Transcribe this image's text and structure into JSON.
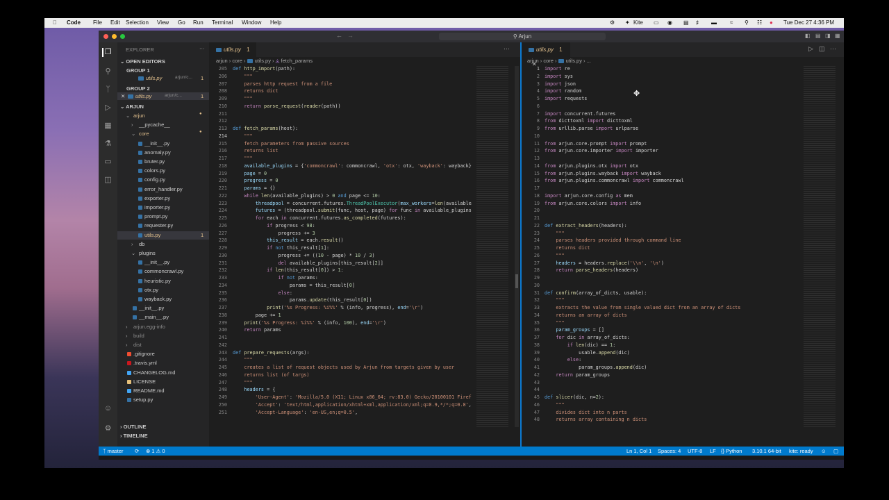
{
  "menubar": {
    "app": "Code",
    "items": [
      "File",
      "Edit",
      "Selection",
      "View",
      "Go",
      "Run",
      "Terminal",
      "Window",
      "Help"
    ],
    "kite": "Kite",
    "clock": "Tue Dec 27  4:36 PM"
  },
  "titlebar": {
    "search": "Arjun"
  },
  "sidebar": {
    "title": "EXPLORER",
    "open_editors": "OPEN EDITORS",
    "group1": "GROUP 1",
    "group1_file": "utils.py",
    "group1_path": "arjun/c...",
    "group1_badge": "1",
    "group2": "GROUP 2",
    "group2_file": "utils.py",
    "group2_path": "arjun/c...",
    "group2_badge": "1",
    "project": "ARJUN",
    "tree": [
      {
        "label": "arjun",
        "indent": 1,
        "kind": "folder",
        "open": true,
        "mod": true
      },
      {
        "label": "__pycache__",
        "indent": 2,
        "kind": "folder",
        "open": false,
        "mod": false
      },
      {
        "label": "core",
        "indent": 2,
        "kind": "folder",
        "open": true,
        "mod": true
      },
      {
        "label": "__init__.py",
        "indent": 3,
        "kind": "file",
        "mod": false
      },
      {
        "label": "anomaly.py",
        "indent": 3,
        "kind": "file",
        "mod": false
      },
      {
        "label": "bruter.py",
        "indent": 3,
        "kind": "file",
        "mod": false
      },
      {
        "label": "colors.py",
        "indent": 3,
        "kind": "file",
        "mod": false
      },
      {
        "label": "config.py",
        "indent": 3,
        "kind": "file",
        "mod": false
      },
      {
        "label": "error_handler.py",
        "indent": 3,
        "kind": "file",
        "mod": false
      },
      {
        "label": "exporter.py",
        "indent": 3,
        "kind": "file",
        "mod": false
      },
      {
        "label": "importer.py",
        "indent": 3,
        "kind": "file",
        "mod": false
      },
      {
        "label": "prompt.py",
        "indent": 3,
        "kind": "file",
        "mod": false
      },
      {
        "label": "requester.py",
        "indent": 3,
        "kind": "file",
        "mod": false
      },
      {
        "label": "utils.py",
        "indent": 3,
        "kind": "file",
        "mod": true,
        "selected": true,
        "badge": "1"
      },
      {
        "label": "db",
        "indent": 2,
        "kind": "folder",
        "open": false,
        "mod": false
      },
      {
        "label": "plugins",
        "indent": 2,
        "kind": "folder",
        "open": true,
        "mod": false
      },
      {
        "label": "__init__.py",
        "indent": 3,
        "kind": "file",
        "mod": false
      },
      {
        "label": "commoncrawl.py",
        "indent": 3,
        "kind": "file",
        "mod": false
      },
      {
        "label": "heuristic.py",
        "indent": 3,
        "kind": "file",
        "mod": false
      },
      {
        "label": "otx.py",
        "indent": 3,
        "kind": "file",
        "mod": false
      },
      {
        "label": "wayback.py",
        "indent": 3,
        "kind": "file",
        "mod": false
      },
      {
        "label": "__init__.py",
        "indent": 2,
        "kind": "file",
        "mod": false
      },
      {
        "label": "__main__.py",
        "indent": 2,
        "kind": "file",
        "mod": false
      },
      {
        "label": "arjun.egg-info",
        "indent": 1,
        "kind": "folder",
        "open": false,
        "mod": false,
        "dim": true
      },
      {
        "label": "build",
        "indent": 1,
        "kind": "folder",
        "open": false,
        "mod": false,
        "dim": true
      },
      {
        "label": "dist",
        "indent": 1,
        "kind": "folder",
        "open": false,
        "mod": false,
        "dim": true
      },
      {
        "label": ".gitignore",
        "indent": 1,
        "kind": "file",
        "mod": false
      },
      {
        "label": ".travis.yml",
        "indent": 1,
        "kind": "file",
        "mod": false
      },
      {
        "label": "CHANGELOG.md",
        "indent": 1,
        "kind": "file",
        "mod": false
      },
      {
        "label": "LICENSE",
        "indent": 1,
        "kind": "file",
        "mod": false
      },
      {
        "label": "README.md",
        "indent": 1,
        "kind": "file",
        "mod": false
      },
      {
        "label": "setup.py",
        "indent": 1,
        "kind": "file",
        "mod": false
      }
    ],
    "outline": "OUTLINE",
    "timeline": "TIMELINE"
  },
  "editor_left": {
    "tab": "utils.py",
    "tab_badge": "1",
    "breadcrumb": [
      "arjun",
      "core",
      "utils.py",
      "fetch_params"
    ],
    "line_start": 205,
    "lines": [
      "<span class='k'>def</span> <span class='fn'>http_import</span>(path):",
      "    <span class='st'>\"\"\"</span>",
      "    <span class='st'>parses http request from a file</span>",
      "    <span class='st'>returns dict</span>",
      "    <span class='st'>\"\"\"</span>",
      "    <span class='kw'>return</span> <span class='fn'>parse_request</span>(<span class='fn'>reader</span>(path))",
      "",
      "",
      "<span class='k'>def</span> <span class='fn'>fetch_params</span>(host):",
      "    <span class='st'>\"\"\"</span>",
      "    <span class='st'>fetch parameters from passive sources</span>",
      "    <span class='st'>returns list</span>",
      "    <span class='st'>\"\"\"</span>",
      "    <span class='vr'>available_plugins</span> = {<span class='st'>'commoncrawl'</span>: commoncrawl, <span class='st'>'otx'</span>: otx, <span class='st'>'wayback'</span>: wayback}",
      "    <span class='vr'>page</span> = <span class='nm'>0</span>",
      "    <span class='vr'>progress</span> = <span class='nm'>0</span>",
      "    <span class='vr'>params</span> = {}",
      "    <span class='kw'>while</span> <span class='fn'>len</span>(available_plugins) > <span class='nm'>0</span> <span class='k'>and</span> page <= <span class='nm'>10</span>:",
      "        <span class='vr'>threadpool</span> = concurrent.futures.<span class='cl'>ThreadPoolExecutor</span>(<span class='vr'>max_workers</span>=<span class='fn'>len</span>(available",
      "        <span class='vr'>futures</span> = (threadpool.<span class='fn'>submit</span>(func, host, page) <span class='kw'>for</span> func <span class='kw'>in</span> available_plugins",
      "        <span class='kw'>for</span> each <span class='kw'>in</span> concurrent.futures.<span class='fn'>as_completed</span>(futures):",
      "            <span class='kw'>if</span> progress < <span class='nm'>98</span>:",
      "                progress += <span class='nm'>3</span>",
      "            <span class='vr'>this_result</span> = each.<span class='fn'>result</span>()",
      "            <span class='kw'>if</span> <span class='k'>not</span> this_result[<span class='nm'>1</span>]:",
      "                progress += ((<span class='nm'>10</span> - page) * <span class='nm'>10</span> / <span class='nm'>3</span>)",
      "                <span class='kw'>del</span> available_plugins[this_result[<span class='nm'>2</span>]]",
      "            <span class='kw'>if</span> <span class='fn'>len</span>(this_result[<span class='nm'>0</span>]) > <span class='nm'>1</span>:",
      "                <span class='kw'>if</span> <span class='k'>not</span> params:",
      "                    params = this_result[<span class='nm'>0</span>]",
      "                <span class='kw'>else</span>:",
      "                    params.<span class='fn'>update</span>(this_result[<span class='nm'>0</span>])",
      "            <span class='fn'>print</span>(<span class='st'>'%s Progress: %i%%'</span> % (info, progress), <span class='vr'>end</span>=<span class='st'>'\\r'</span>)",
      "        page += <span class='nm'>1</span>",
      "    <span class='fn'>print</span>(<span class='st'>'%s Progress: %i%%'</span> % (info, <span class='nm'>100</span>), <span class='vr'>end</span>=<span class='st'>'\\r'</span>)",
      "    <span class='kw'>return</span> params",
      "",
      "",
      "<span class='k'>def</span> <span class='fn'>prepare_requests</span>(args):",
      "    <span class='st'>\"\"\"</span>",
      "    <span class='st'>creates a list of request objects used by Arjun from targets given by user</span>",
      "    <span class='st'>returns list (of targs)</span>",
      "    <span class='st'>\"\"\"</span>",
      "    <span class='vr'>headers</span> = {",
      "        <span class='st'>'User-Agent'</span>: <span class='st'>'Mozilla/5.0 (X11; Linux x86_64; rv:83.0) Gecko/20100101 Firef</span>",
      "        <span class='st'>'Accept'</span>: <span class='st'>'text/html,application/xhtml+xml,application/xml;q=0.9,*/*;q=0.8'</span>,",
      "        <span class='st'>'Accept-Language'</span>: <span class='st'>'en-US,en;q=0.5'</span>,"
    ]
  },
  "editor_right": {
    "tab": "utils.py",
    "tab_badge": "1",
    "breadcrumb": [
      "arjun",
      "core",
      "utils.py",
      "..."
    ],
    "line_start": 1,
    "lines": [
      "<span class='kw'>import</span> re",
      "<span class='kw'>import</span> sys",
      "<span class='kw'>import</span> json",
      "<span class='kw'>import</span> random",
      "<span class='kw'>import</span> requests",
      "",
      "<span class='kw'>import</span> concurrent.futures",
      "<span class='kw'>from</span> dicttoxml <span class='kw'>import</span> dicttoxml",
      "<span class='kw'>from</span> urllib.parse <span class='kw'>import</span> urlparse",
      "",
      "<span class='kw'>from</span> arjun.core.prompt <span class='kw'>import</span> prompt",
      "<span class='kw'>from</span> arjun.core.importer <span class='kw'>import</span> importer",
      "",
      "<span class='kw'>from</span> arjun.plugins.otx <span class='kw'>import</span> otx",
      "<span class='kw'>from</span> arjun.plugins.wayback <span class='kw'>import</span> wayback",
      "<span class='kw'>from</span> arjun.plugins.commoncrawl <span class='kw'>import</span> commoncrawl",
      "",
      "<span class='kw'>import</span> arjun.core.config <span class='kw'>as</span> mem",
      "<span class='kw'>from</span> arjun.core.colors <span class='kw'>import</span> info",
      "",
      "",
      "<span class='k'>def</span> <span class='fn'>extract_headers</span>(headers):",
      "    <span class='st'>\"\"\"</span>",
      "    <span class='st'>parses headers provided through command line</span>",
      "    <span class='st'>returns dict</span>",
      "    <span class='st'>\"\"\"</span>",
      "    <span class='vr'>headers</span> = headers.<span class='fn'>replace</span>(<span class='st'>'\\\\n'</span>, <span class='st'>'\\n'</span>)",
      "    <span class='kw'>return</span> <span class='fn'>parse_headers</span>(headers)",
      "",
      "",
      "<span class='k'>def</span> <span class='fn'>confirm</span>(array_of_dicts, usable):",
      "    <span class='st'>\"\"\"</span>",
      "    <span class='st'>extracts the value from single valued dict from an array of dicts</span>",
      "    <span class='st'>returns an array of dicts</span>",
      "    <span class='st'>\"\"\"</span>",
      "    <span class='vr'>param_groups</span> = []",
      "    <span class='kw'>for</span> dic <span class='kw'>in</span> array_of_dicts:",
      "        <span class='kw'>if</span> <span class='fn'>len</span>(dic) == <span class='nm'>1</span>:",
      "            usable.<span class='fn'>append</span>(dic)",
      "        <span class='kw'>else</span>:",
      "            param_groups.<span class='fn'>append</span>(dic)",
      "    <span class='kw'>return</span> param_groups",
      "",
      "",
      "<span class='k'>def</span> <span class='fn'>slicer</span>(dic, n=<span class='nm'>2</span>):",
      "    <span class='st'>\"\"\"</span>",
      "    <span class='st'>divides dict into n parts</span>",
      "    <span class='st'>returns array containing n dicts</span>"
    ]
  },
  "statusbar": {
    "branch": "master",
    "problems": "⊗ 1  ⚠ 0",
    "position": "Ln 1, Col 1",
    "spaces": "Spaces: 4",
    "encoding": "UTF-8",
    "eol": "LF",
    "language": "Python",
    "interpreter": "3.10.1 64-bit",
    "kite": "kite: ready"
  },
  "colors": {
    "accent": "#007acc",
    "sidebar": "#252526",
    "editor": "#1e1e1e",
    "modified": "#e2c08d"
  }
}
